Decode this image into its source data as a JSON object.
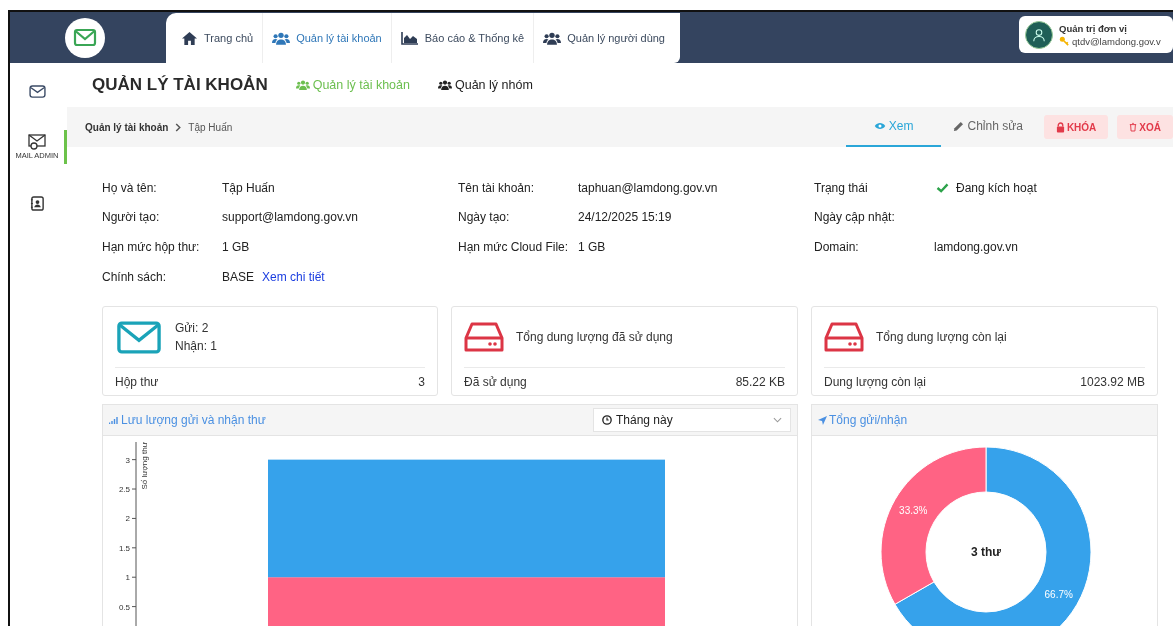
{
  "header": {
    "tabs": [
      {
        "label": "Trang chủ",
        "selected": false
      },
      {
        "label": "Quản lý tài khoản",
        "selected": true
      },
      {
        "label": "Báo cáo & Thống kê",
        "selected": false
      },
      {
        "label": "Quản lý người dùng",
        "selected": false
      }
    ],
    "user": {
      "role": "Quản trị đơn vị",
      "email": "qtdv@lamdong.gov.v"
    }
  },
  "sidebar": {
    "items": [
      {
        "kind": "mail",
        "selected": false
      },
      {
        "kind": "admin",
        "label": "MAIL ADMIN",
        "selected": true
      },
      {
        "kind": "contacts",
        "selected": false
      }
    ]
  },
  "page": {
    "title": "QUẢN LÝ TÀI KHOẢN",
    "subnav": [
      {
        "label": "Quản lý tài khoản",
        "selected": true
      },
      {
        "label": "Quản lý nhóm",
        "selected": false
      }
    ]
  },
  "breadcrumb": [
    "Quản lý tài khoản",
    "Tập Huấn"
  ],
  "actions": [
    {
      "label": "Xem",
      "kind": "tab",
      "selected": true
    },
    {
      "label": "Chỉnh sửa",
      "kind": "tab",
      "selected": false
    },
    {
      "label": "KHÓA",
      "kind": "danger",
      "selected": false
    },
    {
      "label": "XOÁ",
      "kind": "danger",
      "selected": false
    }
  ],
  "fields": [
    {
      "label": "Họ và tên:",
      "value": "Tập Huấn"
    },
    {
      "label": "Tên tài khoản:",
      "value": "taphuan@lamdong.gov.vn"
    },
    {
      "label": "Trạng thái",
      "value": "Đang kích hoạt",
      "kind": "status",
      "active": true
    },
    {
      "label": "Người tạo:",
      "value": "support@lamdong.gov.vn"
    },
    {
      "label": "Ngày tạo:",
      "value": "24/12/2025 15:19"
    },
    {
      "label": "Ngày cập nhật:"
    },
    {
      "label": "Hạn mức hộp thư:",
      "value": "1 GB"
    },
    {
      "label": "Hạn mức Cloud File:",
      "value": "1 GB"
    },
    {
      "label": "Domain:",
      "value": "lamdong.gov.vn"
    },
    {
      "label": "Chính sách:",
      "value": "BASE",
      "link": "Xem chi tiết"
    }
  ],
  "cards": [
    {
      "kind": "mail",
      "lines": [
        "Gửi: 2",
        "Nhận: 1"
      ],
      "footer_label": "Hộp thư",
      "footer_value": "3"
    },
    {
      "kind": "disk",
      "title": "Tổng dung lượng đã sử dụng",
      "footer_label": "Đã sử dụng",
      "footer_value": "85.22 KB"
    },
    {
      "kind": "disk",
      "title": "Tổng dung lượng còn lại",
      "footer_label": "Dung lượng còn lại",
      "footer_value": "1023.92 MB"
    }
  ],
  "traffic": {
    "title": "Lưu lượng gửi và nhận thư",
    "period": "Tháng này",
    "chart_data": {
      "type": "bar",
      "stacked": true,
      "ylabel": "Số lượng thư",
      "ylim": [
        0,
        3.3
      ],
      "yticks": [
        {
          "value": 0.5,
          "label": "0.5"
        },
        {
          "value": 1,
          "label": "1"
        },
        {
          "value": 1.5,
          "label": "1.5"
        },
        {
          "value": 2,
          "label": "2"
        },
        {
          "value": 2.5,
          "label": "2.5"
        },
        {
          "value": 3,
          "label": "3"
        }
      ],
      "series": [
        {
          "color": "#ff6384",
          "values": [
            1
          ]
        },
        {
          "color": "#36a2eb",
          "values": [
            2
          ]
        }
      ]
    }
  },
  "totals": {
    "title": "Tổng gửi/nhận",
    "center_label": "3 thư",
    "chart_data": {
      "type": "donut",
      "data_labels": "value_labels",
      "values": [
        66.7,
        33.3
      ],
      "value_labels": [
        "66.7%",
        "33.3%"
      ],
      "colors": [
        "#36a2eb",
        "#ff6384"
      ]
    }
  }
}
